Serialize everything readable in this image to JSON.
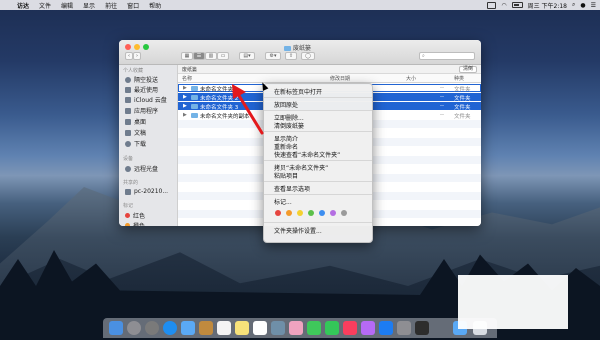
{
  "menubar": {
    "apple": "",
    "items": [
      "访达",
      "文件",
      "编辑",
      "显示",
      "前往",
      "窗口",
      "帮助"
    ],
    "clock": "周三 下午2:18"
  },
  "window": {
    "title": "废纸篓",
    "toolbar_search": "",
    "pathbar": "废纸篓",
    "empty_button": "清倒",
    "columns": {
      "name": "名称",
      "date": "修改日期",
      "size": "大小",
      "kind": "种类"
    },
    "rows": [
      {
        "name": "未命名文件夹",
        "size": "--",
        "kind": "文件夹"
      },
      {
        "name": "未命名文件夹 2",
        "size": "--",
        "kind": "文件夹"
      },
      {
        "name": "未命名文件夹 3",
        "size": "--",
        "kind": "文件夹"
      },
      {
        "name": "未命名文件夹的副本",
        "size": "--",
        "kind": "文件夹"
      }
    ]
  },
  "sidebar": {
    "favorites_header": "个人收藏",
    "favorites": [
      {
        "label": "隔空投送",
        "icon": "airdrop-icon"
      },
      {
        "label": "最近使用",
        "icon": "clock-icon"
      },
      {
        "label": "iCloud 云盘",
        "icon": "cloud-icon"
      },
      {
        "label": "应用程序",
        "icon": "apps-icon"
      },
      {
        "label": "桌面",
        "icon": "desktop-icon"
      },
      {
        "label": "文稿",
        "icon": "document-icon"
      },
      {
        "label": "下载",
        "icon": "download-icon"
      }
    ],
    "devices_header": "设备",
    "devices": [
      {
        "label": "远程光盘",
        "icon": "disc-icon"
      }
    ],
    "shared_header": "共享的",
    "shared": [
      {
        "label": "pc-20210...",
        "icon": "pc-icon"
      }
    ],
    "tags_header": "标记",
    "tags": [
      {
        "label": "红色",
        "color": "#e6453f"
      },
      {
        "label": "橙色",
        "color": "#f39a2b"
      }
    ]
  },
  "context_menu": {
    "items": [
      "在新标签页中打开",
      "放回原处",
      "立即删除...",
      "清倒废纸篓",
      "显示简介",
      "重新命名",
      "快速查看“未命名文件夹”",
      "拷贝“未命名文件夹”",
      "粘贴项目",
      "查看显示选项",
      "标记...",
      "文件夹操作设置..."
    ],
    "tag_colors": [
      "#e6453f",
      "#f39a2b",
      "#f5d130",
      "#5cc04a",
      "#3d8ef0",
      "#b46ee2",
      "#9a9a9a"
    ]
  },
  "colors": {
    "selection": "#2164d3",
    "arrow": "#e3191c"
  }
}
